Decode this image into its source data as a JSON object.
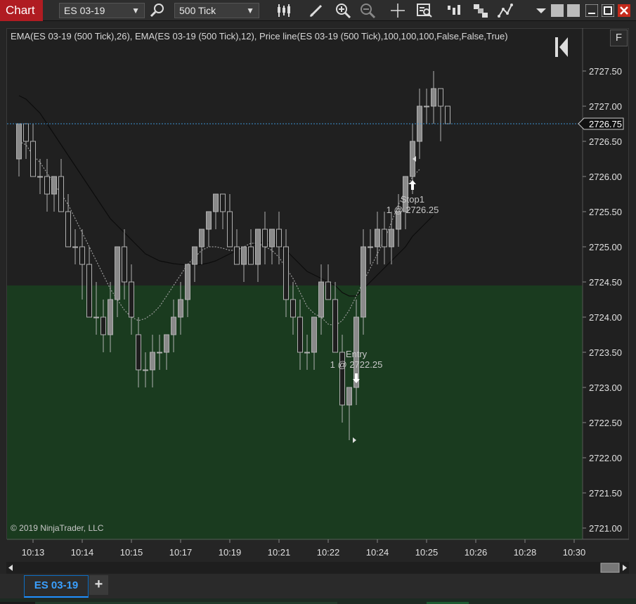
{
  "toolbar": {
    "chart_label": "Chart",
    "instrument": "ES 03-19",
    "interval": "500 Tick"
  },
  "chart": {
    "indicator_label": "EMA(ES 03-19 (500 Tick),26), EMA(ES 03-19 (500 Tick),12), Price line(ES 03-19 (500 Tick),100,100,100,False,False,True)",
    "f_button": "F",
    "copyright": "© 2019 NinjaTrader, LLC",
    "price_line_value": "2726.75",
    "entry_label": "Entry",
    "entry_detail": "1 @ 2722.25",
    "stop_label": "Stop1",
    "stop_detail": "1 @ 2726.25",
    "colors": {
      "up_bar": "#8a8a8a",
      "down_bar": "#1e1e1e",
      "green_zone": "#1a3b1f",
      "price_line": "#3a8fd0"
    }
  },
  "chart_data": {
    "type": "candlestick",
    "y_ticks": [
      "2727.50",
      "2727.00",
      "2726.50",
      "2726.00",
      "2725.50",
      "2725.00",
      "2724.50",
      "2724.00",
      "2723.50",
      "2723.00",
      "2722.50",
      "2722.00",
      "2721.50",
      "2721.00"
    ],
    "x_ticks": [
      "10:13",
      "10:14",
      "10:15",
      "10:17",
      "10:19",
      "10:21",
      "10:22",
      "10:24",
      "10:25",
      "10:26",
      "10:28",
      "10:30"
    ],
    "ylim": [
      2720.75,
      2728.0
    ],
    "green_zone_top": 2724.45,
    "price_line": 2726.75,
    "candles": [
      {
        "o": 2726.25,
        "h": 2726.75,
        "l": 2726.0,
        "c": 2726.75
      },
      {
        "o": 2726.75,
        "h": 2726.75,
        "l": 2726.25,
        "c": 2726.5
      },
      {
        "o": 2726.5,
        "h": 2726.75,
        "l": 2726.0,
        "c": 2726.0
      },
      {
        "o": 2726.0,
        "h": 2726.25,
        "l": 2725.75,
        "c": 2726.0
      },
      {
        "o": 2726.0,
        "h": 2726.25,
        "l": 2725.5,
        "c": 2725.75
      },
      {
        "o": 2725.75,
        "h": 2726.0,
        "l": 2725.5,
        "c": 2726.0
      },
      {
        "o": 2726.0,
        "h": 2726.25,
        "l": 2725.5,
        "c": 2725.5
      },
      {
        "o": 2725.5,
        "h": 2725.75,
        "l": 2725.0,
        "c": 2725.0
      },
      {
        "o": 2725.0,
        "h": 2725.25,
        "l": 2724.75,
        "c": 2725.0
      },
      {
        "o": 2725.0,
        "h": 2725.25,
        "l": 2724.25,
        "c": 2724.75
      },
      {
        "o": 2724.75,
        "h": 2725.0,
        "l": 2724.0,
        "c": 2724.0
      },
      {
        "o": 2724.0,
        "h": 2724.5,
        "l": 2723.75,
        "c": 2724.0
      },
      {
        "o": 2724.0,
        "h": 2724.25,
        "l": 2723.5,
        "c": 2723.75
      },
      {
        "o": 2723.75,
        "h": 2724.5,
        "l": 2723.5,
        "c": 2724.25
      },
      {
        "o": 2724.25,
        "h": 2725.0,
        "l": 2724.0,
        "c": 2725.0
      },
      {
        "o": 2725.0,
        "h": 2725.25,
        "l": 2724.25,
        "c": 2724.5
      },
      {
        "o": 2724.5,
        "h": 2724.75,
        "l": 2723.75,
        "c": 2724.0
      },
      {
        "o": 2723.75,
        "h": 2724.0,
        "l": 2723.0,
        "c": 2723.25
      },
      {
        "o": 2723.25,
        "h": 2723.5,
        "l": 2723.0,
        "c": 2723.25
      },
      {
        "o": 2723.25,
        "h": 2723.75,
        "l": 2723.0,
        "c": 2723.5
      },
      {
        "o": 2723.5,
        "h": 2723.75,
        "l": 2723.25,
        "c": 2723.5
      },
      {
        "o": 2723.5,
        "h": 2723.75,
        "l": 2723.25,
        "c": 2723.75
      },
      {
        "o": 2723.75,
        "h": 2724.25,
        "l": 2723.5,
        "c": 2724.0
      },
      {
        "o": 2724.0,
        "h": 2724.5,
        "l": 2723.75,
        "c": 2724.25
      },
      {
        "o": 2724.25,
        "h": 2724.75,
        "l": 2724.0,
        "c": 2724.75
      },
      {
        "o": 2724.75,
        "h": 2725.0,
        "l": 2724.5,
        "c": 2725.0
      },
      {
        "o": 2725.0,
        "h": 2725.25,
        "l": 2724.75,
        "c": 2725.25
      },
      {
        "o": 2725.25,
        "h": 2725.5,
        "l": 2725.0,
        "c": 2725.5
      },
      {
        "o": 2725.5,
        "h": 2725.75,
        "l": 2725.25,
        "c": 2725.75
      },
      {
        "o": 2725.75,
        "h": 2725.75,
        "l": 2725.25,
        "c": 2725.5
      },
      {
        "o": 2725.5,
        "h": 2725.75,
        "l": 2725.0,
        "c": 2725.0
      },
      {
        "o": 2725.0,
        "h": 2725.25,
        "l": 2724.75,
        "c": 2724.75
      },
      {
        "o": 2724.75,
        "h": 2725.0,
        "l": 2724.5,
        "c": 2725.0
      },
      {
        "o": 2725.0,
        "h": 2725.25,
        "l": 2724.75,
        "c": 2724.75
      },
      {
        "o": 2724.75,
        "h": 2725.25,
        "l": 2724.5,
        "c": 2725.25
      },
      {
        "o": 2725.25,
        "h": 2725.5,
        "l": 2724.75,
        "c": 2725.0
      },
      {
        "o": 2725.0,
        "h": 2725.25,
        "l": 2724.75,
        "c": 2725.25
      },
      {
        "o": 2725.25,
        "h": 2725.5,
        "l": 2724.75,
        "c": 2725.0
      },
      {
        "o": 2725.0,
        "h": 2725.25,
        "l": 2724.0,
        "c": 2724.25
      },
      {
        "o": 2724.25,
        "h": 2724.5,
        "l": 2723.75,
        "c": 2724.0
      },
      {
        "o": 2724.0,
        "h": 2724.25,
        "l": 2723.25,
        "c": 2723.5
      },
      {
        "o": 2723.5,
        "h": 2723.75,
        "l": 2723.25,
        "c": 2723.5
      },
      {
        "o": 2723.5,
        "h": 2724.0,
        "l": 2723.25,
        "c": 2724.0
      },
      {
        "o": 2724.0,
        "h": 2724.75,
        "l": 2723.75,
        "c": 2724.5
      },
      {
        "o": 2724.5,
        "h": 2724.75,
        "l": 2724.25,
        "c": 2724.25
      },
      {
        "o": 2724.25,
        "h": 2724.5,
        "l": 2723.5,
        "c": 2723.5
      },
      {
        "o": 2723.5,
        "h": 2723.75,
        "l": 2722.5,
        "c": 2722.75
      },
      {
        "o": 2722.75,
        "h": 2723.0,
        "l": 2722.25,
        "c": 2723.0
      },
      {
        "o": 2723.0,
        "h": 2724.25,
        "l": 2722.75,
        "c": 2724.0
      },
      {
        "o": 2724.0,
        "h": 2725.25,
        "l": 2723.75,
        "c": 2725.0
      },
      {
        "o": 2725.0,
        "h": 2725.25,
        "l": 2724.75,
        "c": 2725.0
      },
      {
        "o": 2725.0,
        "h": 2725.5,
        "l": 2724.75,
        "c": 2725.25
      },
      {
        "o": 2725.25,
        "h": 2725.5,
        "l": 2724.75,
        "c": 2725.0
      },
      {
        "o": 2725.0,
        "h": 2725.5,
        "l": 2724.75,
        "c": 2725.25
      },
      {
        "o": 2725.25,
        "h": 2725.75,
        "l": 2725.0,
        "c": 2725.5
      },
      {
        "o": 2725.5,
        "h": 2726.0,
        "l": 2725.25,
        "c": 2726.0
      },
      {
        "o": 2726.0,
        "h": 2726.75,
        "l": 2725.75,
        "c": 2726.5
      },
      {
        "o": 2726.5,
        "h": 2727.25,
        "l": 2726.25,
        "c": 2727.0
      },
      {
        "o": 2727.0,
        "h": 2727.25,
        "l": 2726.75,
        "c": 2727.0
      },
      {
        "o": 2727.0,
        "h": 2727.5,
        "l": 2726.75,
        "c": 2727.25
      },
      {
        "o": 2727.25,
        "h": 2727.25,
        "l": 2726.5,
        "c": 2727.0
      },
      {
        "o": 2727.0,
        "h": 2727.0,
        "l": 2726.75,
        "c": 2726.75
      }
    ],
    "ema26": [
      2727.15,
      2727.1,
      2727.0,
      2726.9,
      2726.75,
      2726.6,
      2726.45,
      2726.3,
      2726.15,
      2726.0,
      2725.85,
      2725.7,
      2725.55,
      2725.4,
      2725.3,
      2725.2,
      2725.1,
      2725.0,
      2724.9,
      2724.85,
      2724.8,
      2724.78,
      2724.76,
      2724.75,
      2724.74,
      2724.74,
      2724.75,
      2724.77,
      2724.8,
      2724.85,
      2724.9,
      2724.95,
      2725.0,
      2725.02,
      2725.05,
      2725.07,
      2725.05,
      2725.0,
      2724.95,
      2724.85,
      2724.75,
      2724.65,
      2724.6,
      2724.55,
      2724.5,
      2724.45,
      2724.35,
      2724.3,
      2724.3,
      2724.4,
      2724.5,
      2724.6,
      2724.7,
      2724.8,
      2724.9,
      2725.0,
      2725.15,
      2725.25,
      2725.35,
      2725.45
    ],
    "ema12": [
      2726.5,
      2726.45,
      2726.3,
      2726.2,
      2726.05,
      2725.9,
      2725.75,
      2725.6,
      2725.4,
      2725.2,
      2725.0,
      2724.8,
      2724.6,
      2724.4,
      2724.25,
      2724.1,
      2724.0,
      2723.95,
      2723.98,
      2724.05,
      2724.15,
      2724.3,
      2724.45,
      2724.6,
      2724.75,
      2724.85,
      2724.95,
      2725.0,
      2725.0,
      2724.98,
      2724.95,
      2724.95,
      2725.0,
      2725.05,
      2725.05,
      2725.0,
      2724.95,
      2724.85,
      2724.7,
      2724.55,
      2724.35,
      2724.15,
      2724.05,
      2724.0,
      2723.9,
      2723.88,
      2723.95,
      2724.1,
      2724.3,
      2724.5,
      2724.7,
      2724.9,
      2725.1,
      2725.35,
      2725.6,
      2725.8,
      2726.0,
      2726.1
    ]
  },
  "tabs": {
    "active": "ES 03-19",
    "add": "+"
  }
}
